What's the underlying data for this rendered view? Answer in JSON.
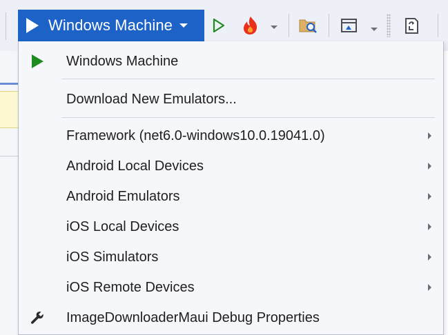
{
  "toolbar": {
    "run_target_label": "Windows Machine",
    "icons": [
      "play-outline-icon",
      "hot-reload-icon",
      "folder-search-icon",
      "window-icon",
      "document-refresh-icon"
    ]
  },
  "menu": {
    "items": [
      {
        "label": "Windows Machine",
        "icon": "play-icon",
        "has_submenu": false
      },
      {
        "label": "Download New Emulators...",
        "icon": "",
        "has_submenu": false
      },
      {
        "label": "Framework (net6.0-windows10.0.19041.0)",
        "icon": "",
        "has_submenu": true
      },
      {
        "label": "Android Local Devices",
        "icon": "",
        "has_submenu": true
      },
      {
        "label": "Android Emulators",
        "icon": "",
        "has_submenu": true
      },
      {
        "label": "iOS Local Devices",
        "icon": "",
        "has_submenu": true
      },
      {
        "label": "iOS Simulators",
        "icon": "",
        "has_submenu": true
      },
      {
        "label": "iOS Remote Devices",
        "icon": "",
        "has_submenu": true
      },
      {
        "label": "ImageDownloaderMaui Debug Properties",
        "icon": "wrench-icon",
        "has_submenu": false
      }
    ]
  },
  "colors": {
    "accent": "#1d62c6",
    "play_green": "#1f8a1f",
    "menu_bg": "#f6f7fb",
    "toolbar_bg": "#eef0f7"
  }
}
